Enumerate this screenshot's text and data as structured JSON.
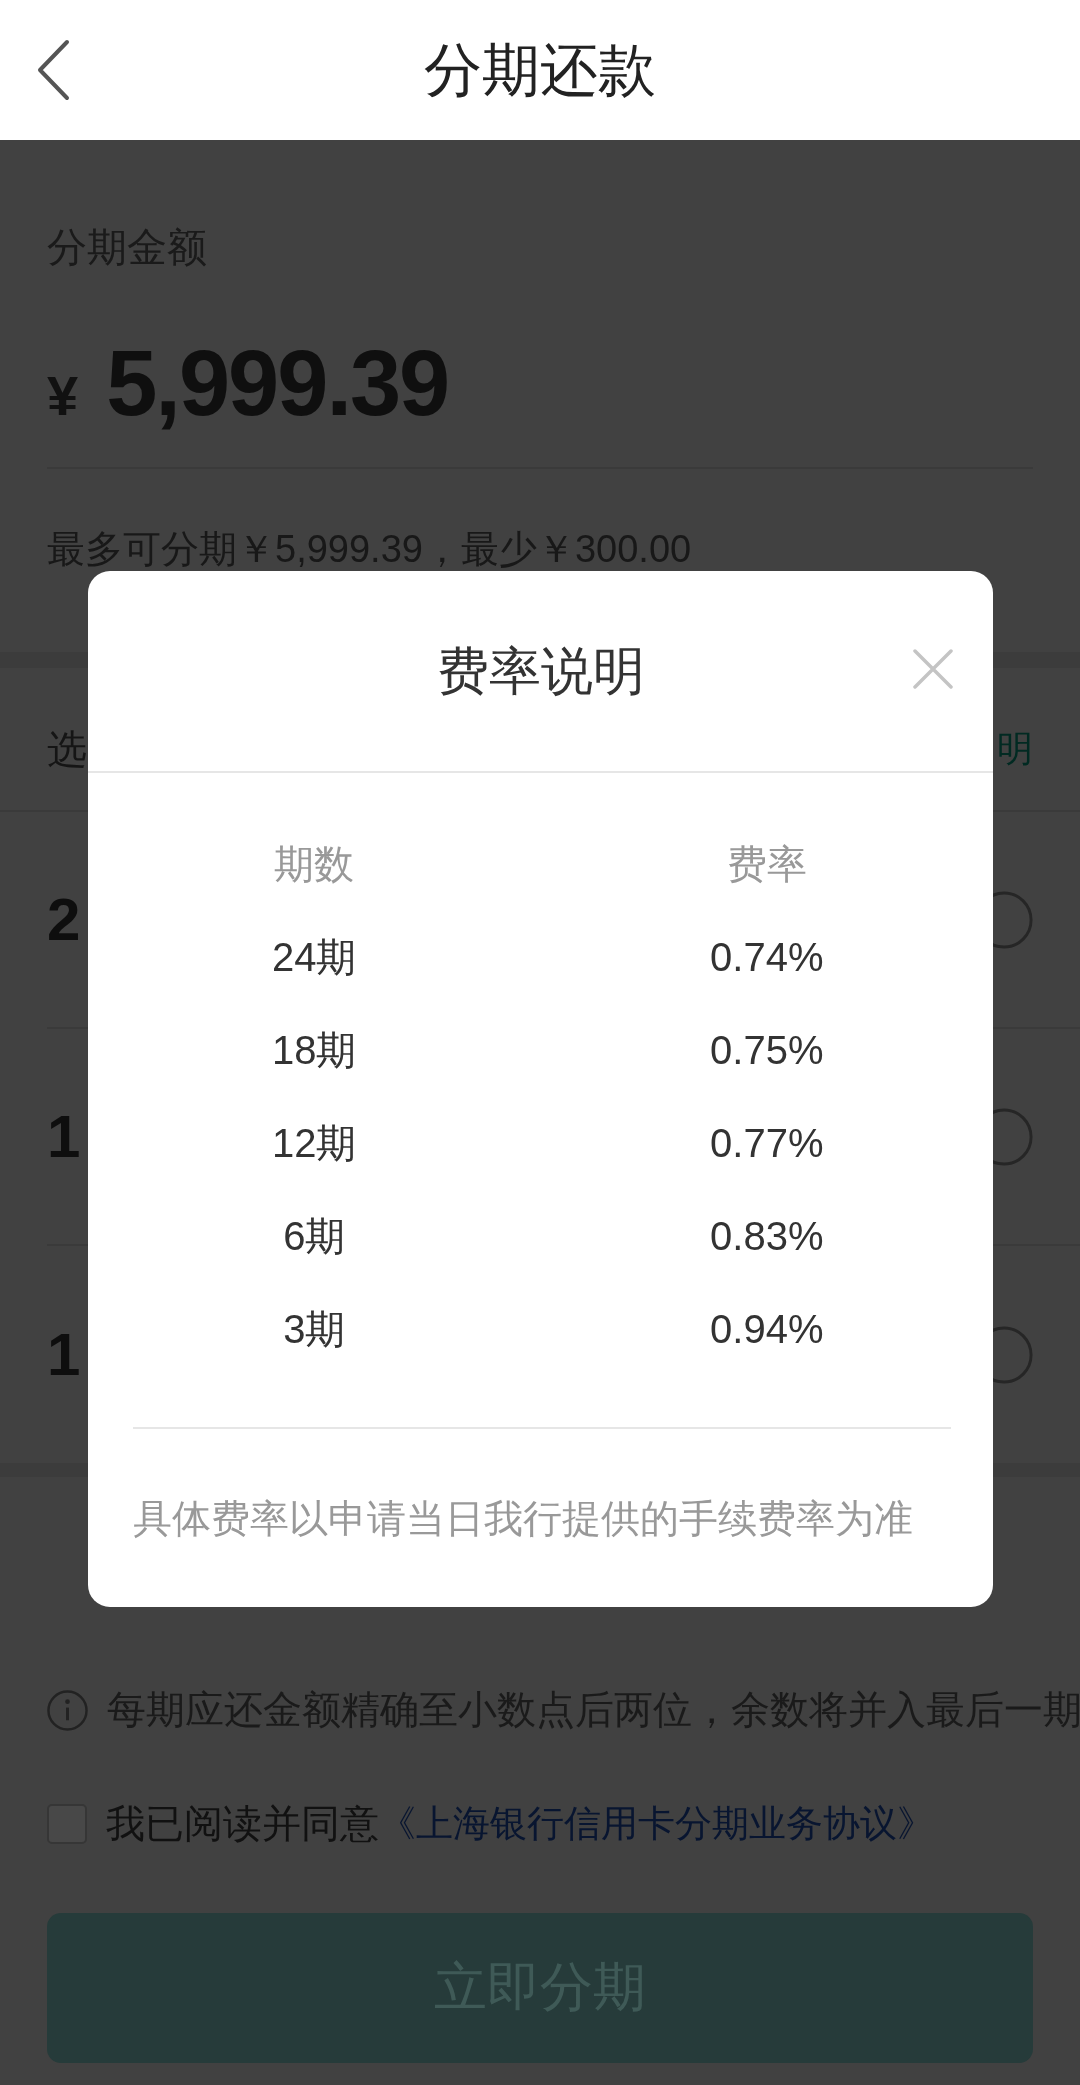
{
  "header": {
    "title": "分期还款"
  },
  "amount_card": {
    "label": "分期金额",
    "currency": "¥",
    "amount": "5,999.39",
    "hint": "最多可分期￥5,999.39，最少￥300.00"
  },
  "plan_card": {
    "heading": "选",
    "link": "明",
    "plans": [
      {
        "term": "2",
        "selected": false
      },
      {
        "term": "1",
        "selected": false
      },
      {
        "term": "1",
        "selected": false
      }
    ]
  },
  "notice": {
    "text": "每期应还金额精确至小数点后两位，余数将并入最后一期"
  },
  "agreement": {
    "checked": false,
    "text": "我已阅读并同意",
    "link": "《上海银行信用卡分期业务协议》"
  },
  "submit_button": {
    "label": "立即分期",
    "disabled": true
  },
  "modal": {
    "title": "费率说明",
    "columns": [
      "期数",
      "费率"
    ],
    "rows": [
      {
        "term": "24期",
        "rate": "0.74%"
      },
      {
        "term": "18期",
        "rate": "0.75%"
      },
      {
        "term": "12期",
        "rate": "0.77%"
      },
      {
        "term": "6期",
        "rate": "0.83%"
      },
      {
        "term": "3期",
        "rate": "0.94%"
      }
    ],
    "footnote": "具体费率以申请当日我行提供的手续费率为准"
  }
}
